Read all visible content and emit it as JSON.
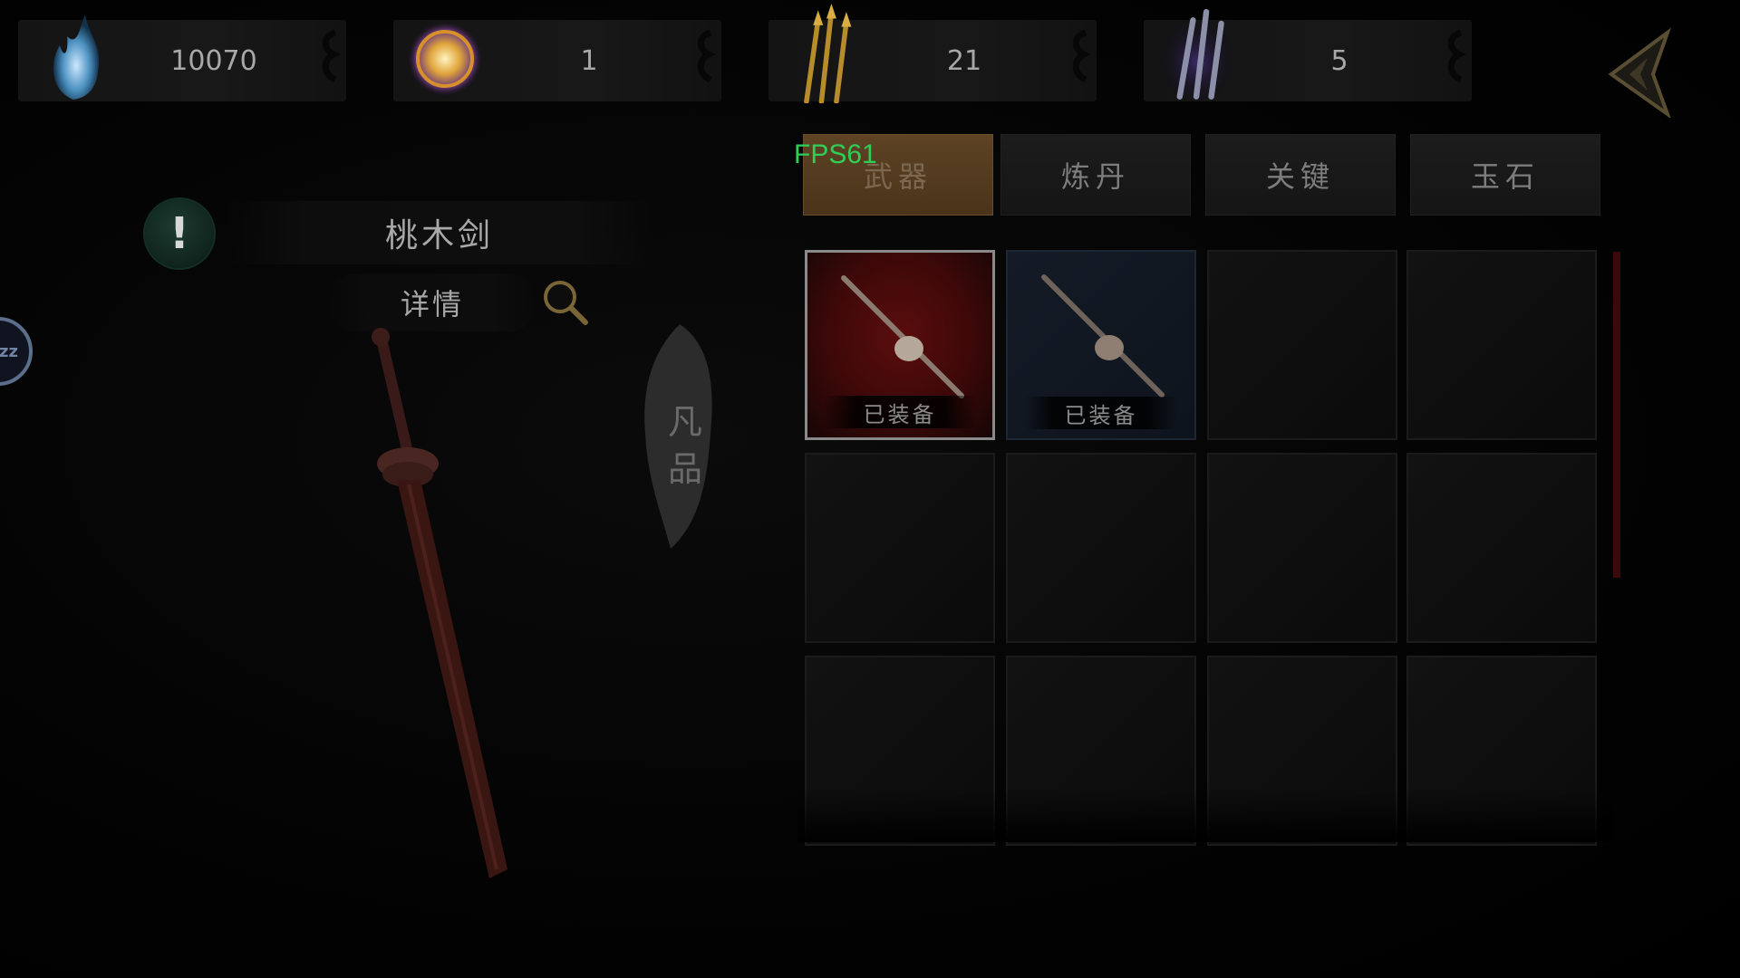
{
  "resources": [
    {
      "icon": "spirit-flame-icon",
      "value": "10070"
    },
    {
      "icon": "golden-orb-icon",
      "value": "1"
    },
    {
      "icon": "golden-arrows-icon",
      "value": "21"
    },
    {
      "icon": "iron-knives-icon",
      "value": "5"
    }
  ],
  "item": {
    "name": "桃木剑",
    "detail_label": "详情",
    "grade": "凡品"
  },
  "side_badge": "zz",
  "fps": "FPS61",
  "tabs": [
    {
      "label": "武器",
      "active": true
    },
    {
      "label": "炼丹",
      "active": false
    },
    {
      "label": "关键",
      "active": false
    },
    {
      "label": "玉石",
      "active": false
    }
  ],
  "inventory": {
    "slots": [
      {
        "label": "已装备",
        "selected": true,
        "bg": "red"
      },
      {
        "label": "已装备",
        "selected": false,
        "bg": "blue"
      },
      {
        "label": "",
        "selected": false
      },
      {
        "label": "",
        "selected": false
      },
      {
        "label": "",
        "selected": false
      },
      {
        "label": "",
        "selected": false
      },
      {
        "label": "",
        "selected": false
      },
      {
        "label": "",
        "selected": false
      },
      {
        "label": "",
        "selected": false
      },
      {
        "label": "",
        "selected": false
      },
      {
        "label": "",
        "selected": false
      },
      {
        "label": "",
        "selected": false
      }
    ]
  },
  "colors": {
    "fps": "#2ecf54",
    "active_tab": "#5e4324",
    "equipped_red": "#5a0d0d"
  }
}
